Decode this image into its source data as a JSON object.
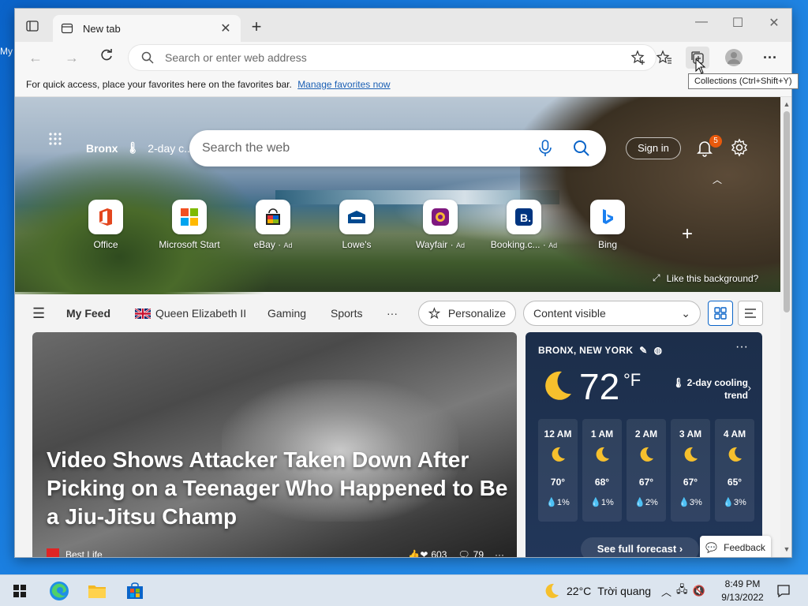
{
  "desktop": {
    "icon_label": "My"
  },
  "browser": {
    "tab": {
      "title": "New tab"
    },
    "addressbar": {
      "placeholder": "Search or enter web address"
    },
    "favbar": {
      "text": "For quick access, place your favorites here on the favorites bar.",
      "link": "Manage favorites now"
    },
    "tooltip": "Collections (Ctrl+Shift+Y)"
  },
  "newtab": {
    "location": "Bronx",
    "weather_short": "2-day c...",
    "search_placeholder": "Search the web",
    "sign_in": "Sign in",
    "notifications_count": "5",
    "quicklinks": [
      {
        "label": "Office",
        "ad": "",
        "icon": "office-icon"
      },
      {
        "label": "Microsoft Start",
        "ad": "",
        "icon": "microsoft-icon"
      },
      {
        "label": "eBay",
        "ad": "Ad",
        "icon": "ebay-icon"
      },
      {
        "label": "Lowe's",
        "ad": "",
        "icon": "lowes-icon"
      },
      {
        "label": "Wayfair",
        "ad": "Ad",
        "icon": "wayfair-icon"
      },
      {
        "label": "Booking.c...",
        "ad": "Ad",
        "icon": "booking-icon"
      },
      {
        "label": "Bing",
        "ad": "",
        "icon": "bing-icon"
      }
    ],
    "like_background": "Like this background?",
    "feed": {
      "tabs": [
        "My Feed",
        "Queen Elizabeth II",
        "Gaming",
        "Sports"
      ],
      "more": "···",
      "personalize": "Personalize",
      "content_visible": "Content visible"
    },
    "main_story": {
      "title": "Video Shows Attacker Taken Down After Picking on a Teenager Who Happened to Be a Jiu-Jitsu Champ",
      "source": "Best Life",
      "reactions": "603",
      "comments": "79"
    },
    "weather": {
      "location": "BRONX, NEW YORK",
      "temp": "72",
      "unit": "°F",
      "trend": "2-day cooling trend",
      "hours": [
        {
          "time": "12 AM",
          "temp": "70°",
          "precip": "1%"
        },
        {
          "time": "1 AM",
          "temp": "68°",
          "precip": "1%"
        },
        {
          "time": "2 AM",
          "temp": "67°",
          "precip": "2%"
        },
        {
          "time": "3 AM",
          "temp": "67°",
          "precip": "3%"
        },
        {
          "time": "4 AM",
          "temp": "65°",
          "precip": "3%"
        }
      ],
      "forecast_link": "See full forecast"
    },
    "feedback": "Feedback"
  },
  "taskbar": {
    "weather_temp": "22°C",
    "weather_desc": "Trời quang",
    "time": "8:49 PM",
    "date": "9/13/2022"
  },
  "colors": {
    "accent": "#0a64c8",
    "badge": "#e8590c",
    "weather_bg": "#1c2e4a"
  }
}
